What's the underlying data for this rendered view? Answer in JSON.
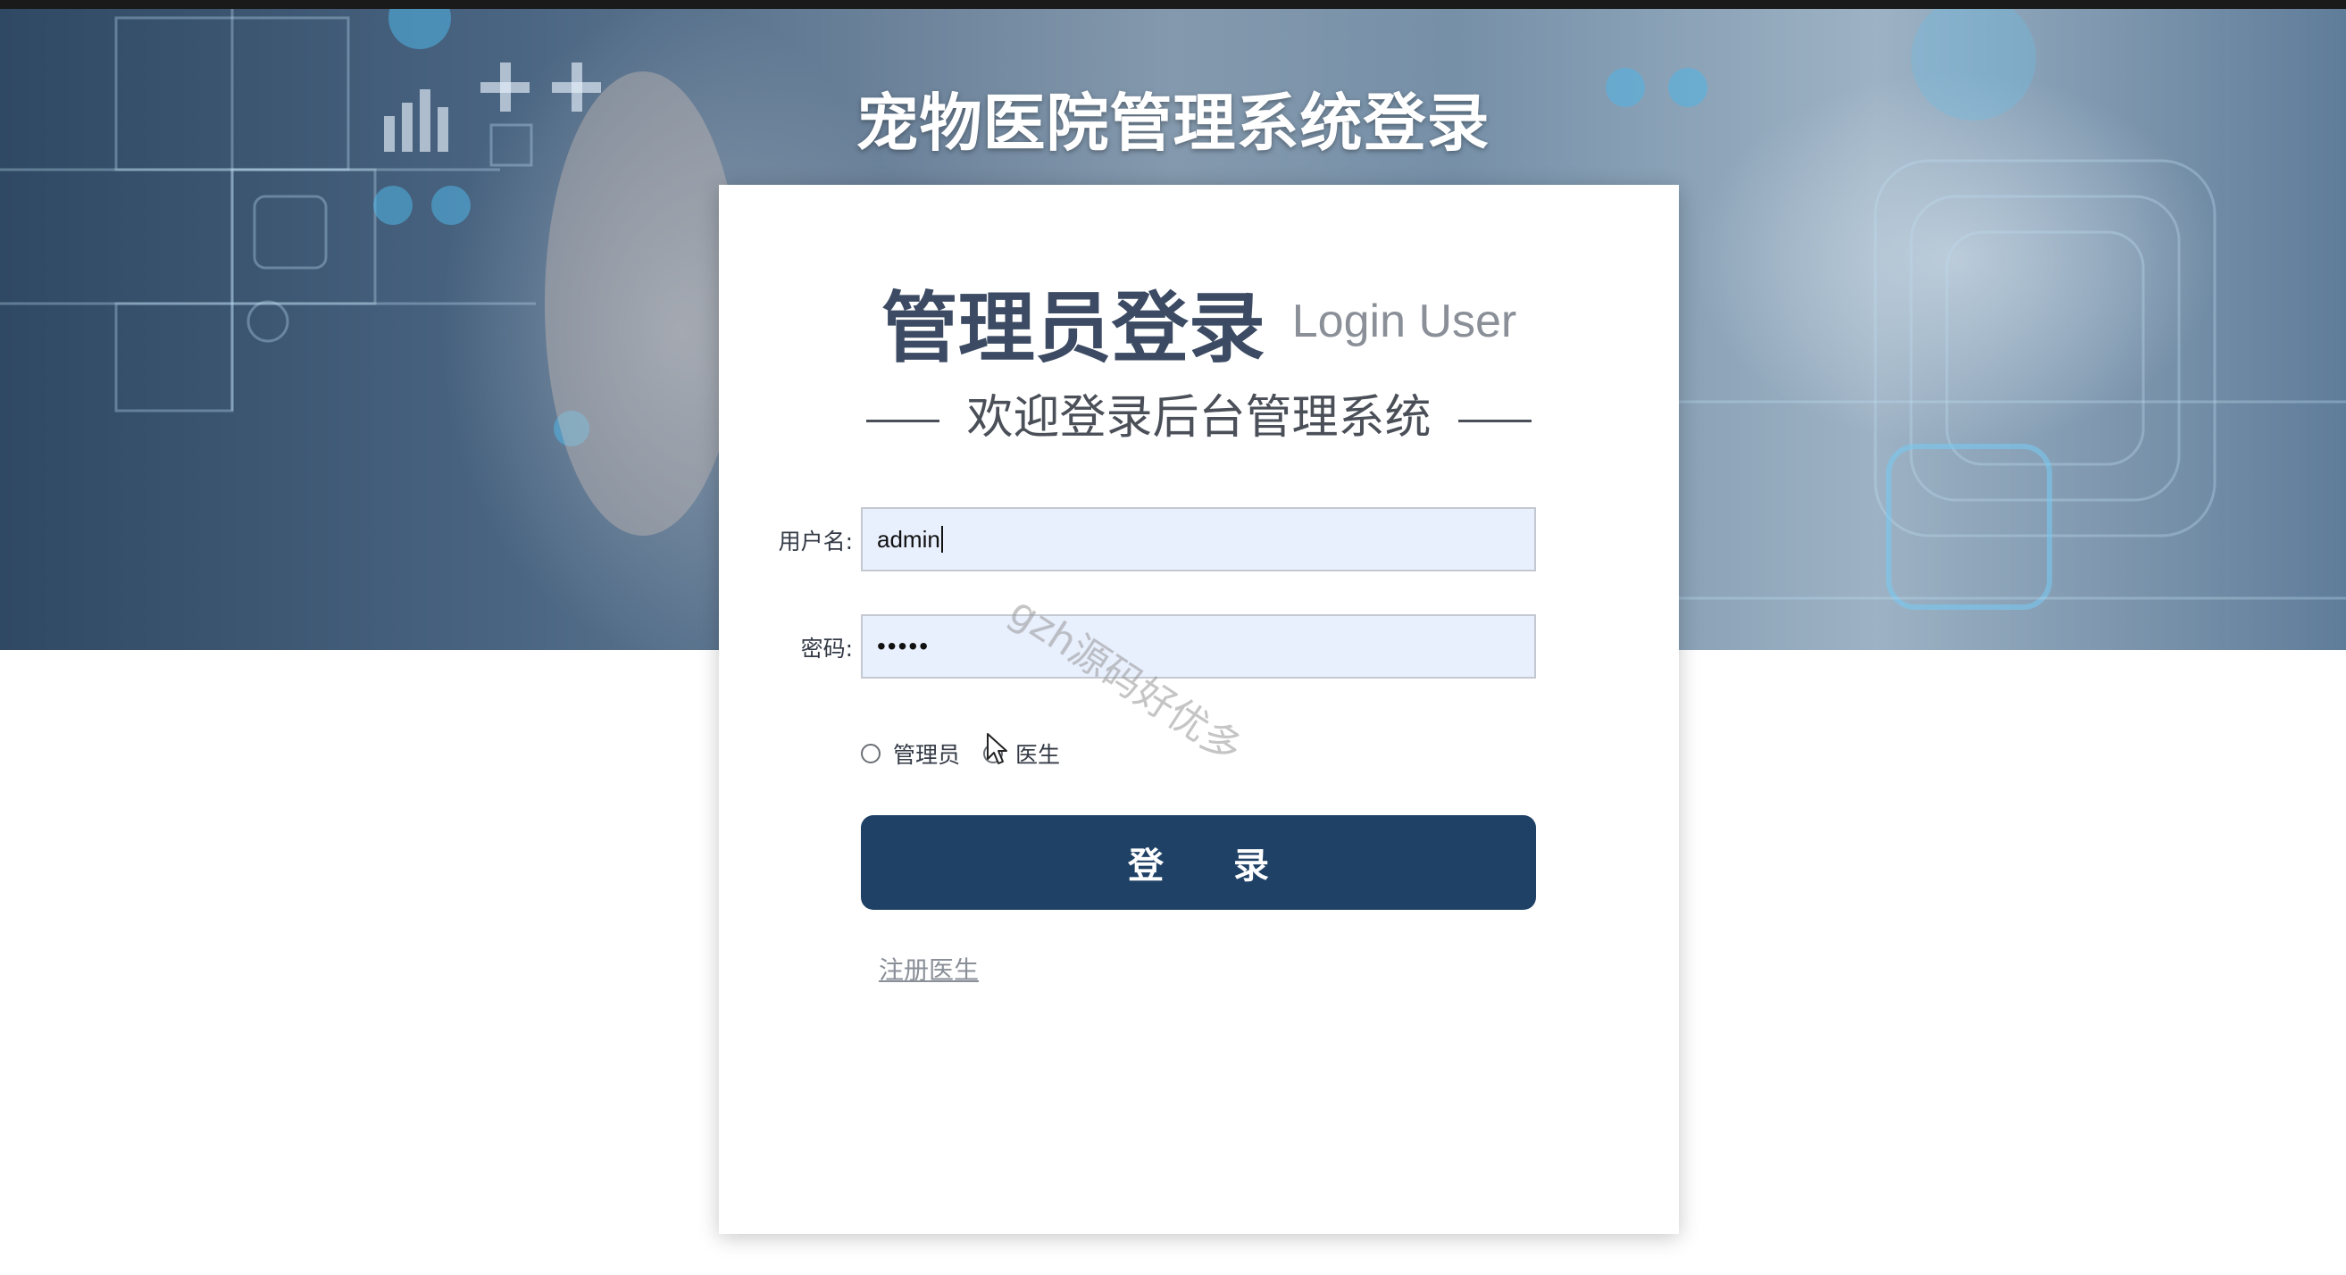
{
  "page": {
    "title": "宠物医院管理系统登录"
  },
  "card": {
    "heading": "管理员登录",
    "heading_en": "Login User",
    "subtitle": "欢迎登录后台管理系统"
  },
  "form": {
    "username_label": "用户名:",
    "username_value": "admin",
    "password_label": "密码:",
    "password_masked": "•••••",
    "roles": [
      {
        "label": "管理员",
        "selected": false
      },
      {
        "label": "医生",
        "selected": false
      }
    ],
    "login_button": "登 录",
    "register_link": "注册医生"
  },
  "watermark": "gzh源码好优多",
  "colors": {
    "button": "#1f4166",
    "input_bg": "#e8effd",
    "heading": "#3c4b63"
  },
  "icons": {
    "cursor": "mouse-pointer-icon"
  }
}
